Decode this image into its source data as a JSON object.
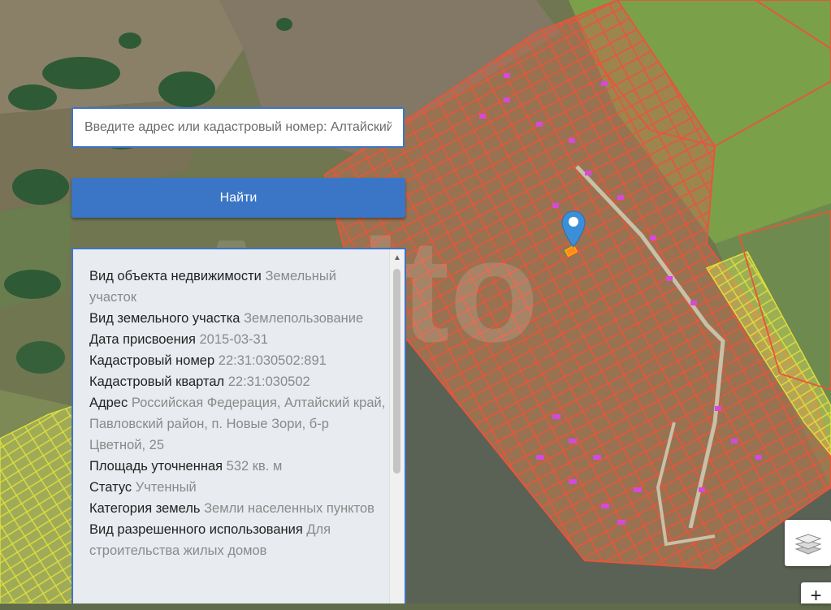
{
  "search": {
    "placeholder": "Введите адрес или кадастровый номер: Алтайский край"
  },
  "find_button": {
    "label": "Найти"
  },
  "info": {
    "rows": [
      {
        "label": "Вид объекта недвижимости",
        "value": "Земельный участок"
      },
      {
        "label": "Вид земельного участка",
        "value": "Землепользование"
      },
      {
        "label": "Дата присвоения",
        "value": "2015-03-31"
      },
      {
        "label": "Кадастровый номер",
        "value": "22:31:030502:891"
      },
      {
        "label": "Кадастровый квартал",
        "value": "22:31:030502"
      },
      {
        "label": "Адрес",
        "value": "Российская Федерация, Алтайский край, Павловский район, п. Новые Зори, б-р Цветной, 25"
      },
      {
        "label": "Площадь уточненная",
        "value": "532 кв. м"
      },
      {
        "label": "Статус",
        "value": "Учтенный"
      },
      {
        "label": "Категория земель",
        "value": "Земли населенных пунктов"
      },
      {
        "label": "Вид разрешенного использования",
        "value": "Для строительства жилых домов"
      }
    ]
  },
  "map_controls": {
    "zoom_in": "+"
  },
  "icons": {
    "pin": "map-pin-icon",
    "layers": "layers-icon",
    "scroll_up": "chevron-up-icon"
  },
  "colors": {
    "accent": "#3b76c6",
    "parcel_border": "#e8553a",
    "parcel_yellow": "#e6f04a",
    "pin": "#3a8fd8"
  }
}
